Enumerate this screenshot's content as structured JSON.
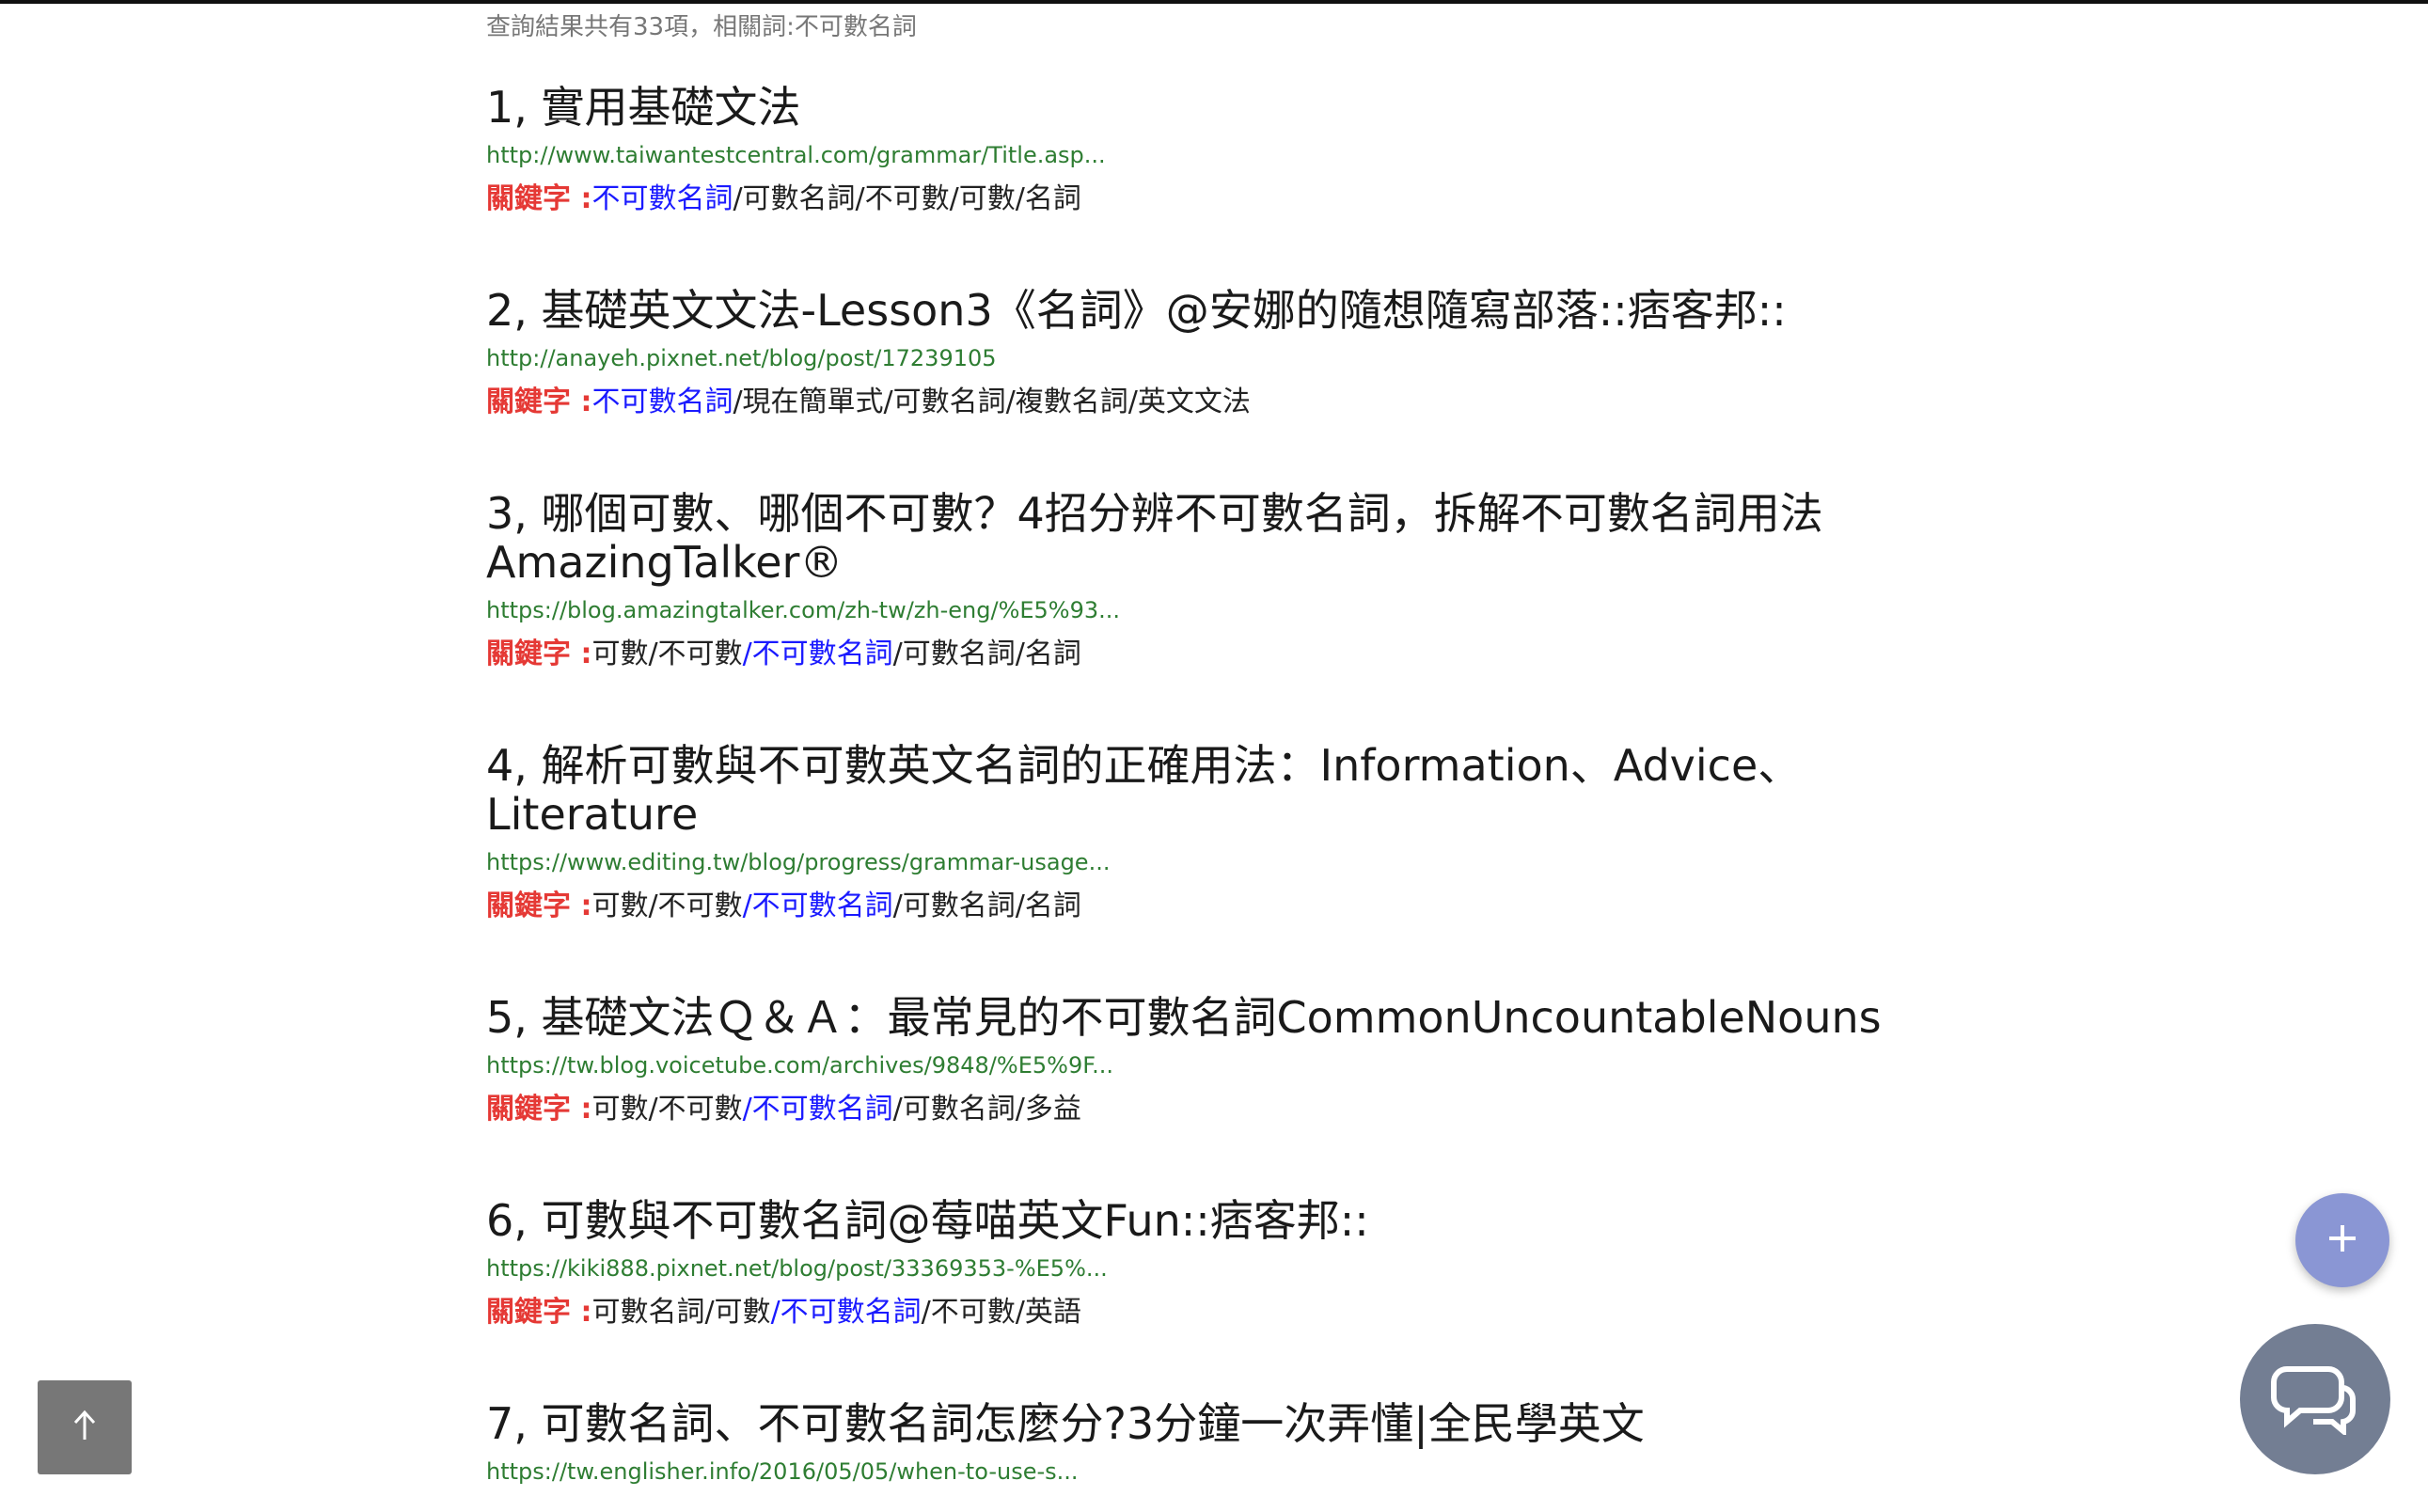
{
  "summary": "查詢結果共有33項，相關詞:不可數名詞",
  "keyword_label": "關鍵字 :",
  "results": [
    {
      "title": "1, 實用基礎文法",
      "url": "http://www.taiwantestcentral.com/grammar/Title.asp...",
      "kw_before": "",
      "kw_highlight": "不可數名詞",
      "kw_after": "/可數名詞/不可數/可數/名詞"
    },
    {
      "title": "2, 基礎英文文法-Lesson3《名詞》@安娜的隨想隨寫部落::痞客邦::",
      "url": "http://anayeh.pixnet.net/blog/post/17239105",
      "kw_before": "",
      "kw_highlight": "不可數名詞",
      "kw_after": "/現在簡單式/可數名詞/複數名詞/英文文法"
    },
    {
      "title": "3, 哪個可數、哪個不可數？4招分辨不可數名詞，拆解不可數名詞用法 AmazingTalker®",
      "url": "https://blog.amazingtalker.com/zh-tw/zh-eng/%E5%93...",
      "kw_before": "可數/不可數",
      "kw_highlight": "/不可數名詞",
      "kw_after": "/可數名詞/名詞"
    },
    {
      "title": "4, 解析可數與不可數英文名詞的正確用法：Information、Advice、Literature",
      "url": "https://www.editing.tw/blog/progress/grammar-usage...",
      "kw_before": "可數/不可數",
      "kw_highlight": "/不可數名詞",
      "kw_after": "/可數名詞/名詞"
    },
    {
      "title": "5, 基礎文法Ｑ＆Ａ：最常見的不可數名詞CommonUncountableNouns",
      "url": "https://tw.blog.voicetube.com/archives/9848/%E5%9F...",
      "kw_before": "可數/不可數",
      "kw_highlight": "/不可數名詞",
      "kw_after": "/可數名詞/多益"
    },
    {
      "title": "6, 可數與不可數名詞@莓喵英文Fun::痞客邦::",
      "url": "https://kiki888.pixnet.net/blog/post/33369353-%E5%...",
      "kw_before": "可數名詞/可數",
      "kw_highlight": "/不可數名詞",
      "kw_after": "/不可數/英語"
    },
    {
      "title": "7, 可數名詞、不可數名詞怎麼分?3分鐘一次弄懂|全民學英文",
      "url": "https://tw.englisher.info/2016/05/05/when-to-use-s...",
      "kw_before": "",
      "kw_highlight": "",
      "kw_after": ""
    }
  ],
  "buttons": {
    "scroll_top_icon": "arrow-up-icon",
    "add_icon": "plus-icon",
    "chat_icon": "chat-bubbles-icon"
  },
  "colors": {
    "keyword_label": "#e53935",
    "keyword_highlight": "#1a1aff",
    "url": "#2e7d32",
    "fab_plus": "#8a96d4",
    "fab_chat": "#737e93",
    "scroll_top": "#777777"
  }
}
